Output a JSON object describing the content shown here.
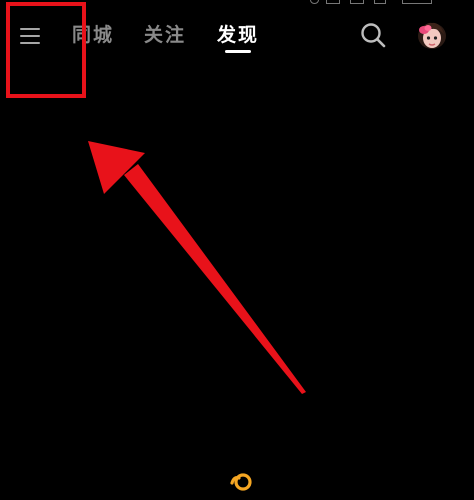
{
  "header": {
    "tabs": [
      {
        "label": "同城",
        "active": false
      },
      {
        "label": "关注",
        "active": false
      },
      {
        "label": "发现",
        "active": true
      }
    ],
    "menu_icon": "hamburger-menu-icon",
    "search_icon": "search-icon",
    "avatar_icon": "user-avatar"
  },
  "annotation": {
    "box_color": "#e8121a",
    "arrow_color": "#e8121a",
    "target": "menu-button"
  },
  "loading_icon": "loading-spinner-icon",
  "colors": {
    "background": "#000000",
    "active_tab": "#ffffff",
    "inactive_tab": "#8a8a8a",
    "accent": "#f5a623"
  }
}
